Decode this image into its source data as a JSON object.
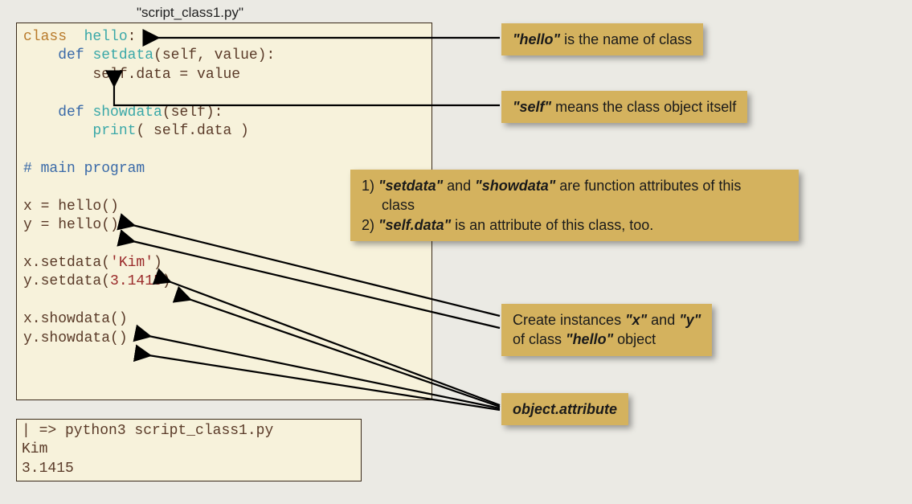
{
  "filename": "\"script_class1.py\"",
  "code": {
    "l1a": "class",
    "l1b": "hello",
    "l1c": ":",
    "l2a": "def",
    "l2b": "setdata",
    "l2c": "(self, value):",
    "l3": "        self.data = value",
    "l5a": "def",
    "l5b": "showdata",
    "l5c": "(self):",
    "l6a": "print",
    "l6b": "( self.data )",
    "l8": "# main program",
    "l10": "x = hello()",
    "l11": "y = hello()",
    "l13a": "x.setdata(",
    "l13b": "'Kim'",
    "l13c": ")",
    "l14a": "y.setdata(",
    "l14b": "3.1415",
    "l14c": ")",
    "l16": "x.showdata()",
    "l17": "y.showdata()"
  },
  "output": {
    "l1": "| => python3 script_class1.py",
    "l2": "Kim",
    "l3": "3.1415"
  },
  "notes": {
    "n1_a": "\"hello\"",
    "n1_b": " is the name of class",
    "n2_a": "\"self\"",
    "n2_b": " means the class object itself",
    "n3_l1a": "1)  ",
    "n3_l1b": "\"setdata\"",
    "n3_l1c": " and ",
    "n3_l1d": "\"showdata\"",
    "n3_l1e": " are function attributes of this",
    "n3_l2": "     class",
    "n3_l3a": "2)  ",
    "n3_l3b": "\"self.data\"",
    "n3_l3c": " is an attribute of this class, too.",
    "n4_a": "Create instances ",
    "n4_b": "\"x\"",
    "n4_c": " and ",
    "n4_d": "\"y\"",
    "n4_e": "of class ",
    "n4_f": "\"hello\"",
    "n4_g": " object",
    "n5": "object.attribute"
  }
}
